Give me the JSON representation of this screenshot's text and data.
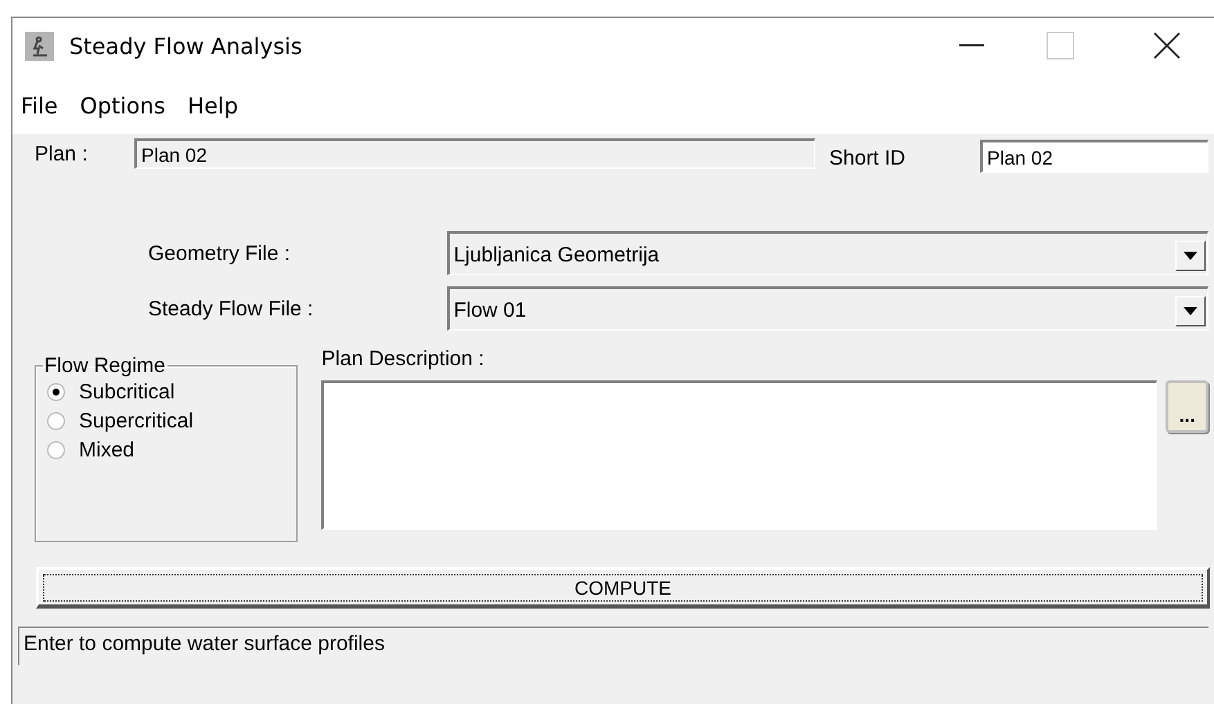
{
  "window": {
    "title": "Steady Flow Analysis"
  },
  "menu": [
    "File",
    "Options",
    "Help"
  ],
  "plan": {
    "label": "Plan :",
    "value": "Plan 02"
  },
  "short_id": {
    "label": "Short ID",
    "value": "Plan 02"
  },
  "geometry_file": {
    "label": "Geometry File :",
    "value": "Ljubljanica Geometrija"
  },
  "steady_flow_file": {
    "label": "Steady Flow File :",
    "value": "Flow 01"
  },
  "flow_regime": {
    "title": "Flow Regime",
    "options": [
      {
        "label": "Subcritical",
        "selected": true
      },
      {
        "label": "Supercritical",
        "selected": false
      },
      {
        "label": "Mixed",
        "selected": false
      }
    ]
  },
  "plan_description": {
    "label": "Plan Description :",
    "button": "..."
  },
  "compute_button": "COMPUTE",
  "status_bar": "Enter to compute water surface profiles"
}
